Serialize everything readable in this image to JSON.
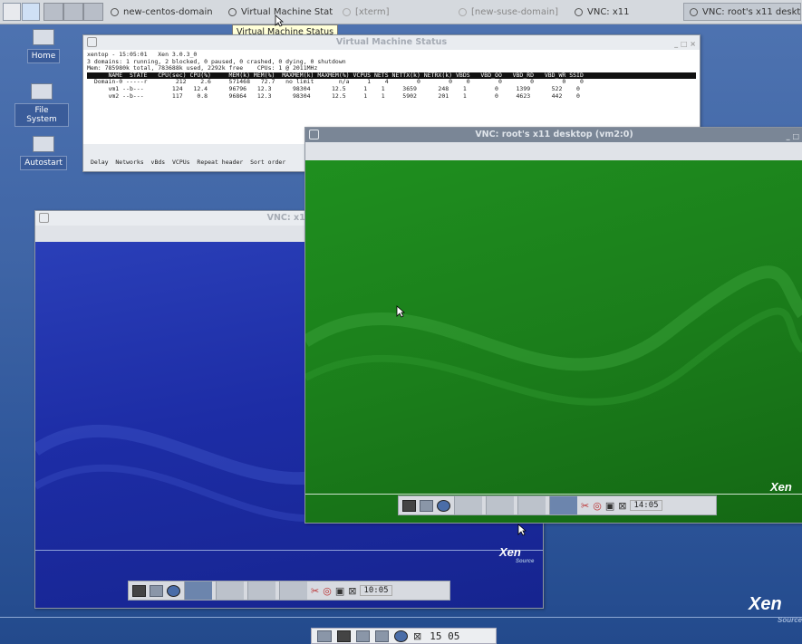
{
  "taskbar": {
    "tasks": [
      {
        "label": "new-centos-domain"
      },
      {
        "label": "Virtual Machine Status"
      },
      {
        "label": "[xterm]"
      },
      {
        "label": "[new-suse-domain]"
      },
      {
        "label": "VNC: x11"
      },
      {
        "label": "VNC: root's x11 deskto..."
      }
    ],
    "tooltip": "Virtual Machine Status"
  },
  "desktop_icons": [
    {
      "label": "Home"
    },
    {
      "label": "File System"
    },
    {
      "label": "Autostart"
    }
  ],
  "vm_status_window": {
    "title": "Virtual Machine Status",
    "lines": [
      "xentop - 15:05:01   Xen 3.0.3_0",
      "3 domains: 1 running, 2 blocked, 0 paused, 0 crashed, 0 dying, 0 shutdown",
      "Mem: 785980k total, 783688k used, 2292k free    CPUs: 1 @ 2011MHz"
    ],
    "header": "      NAME  STATE   CPU(sec) CPU(%)     MEM(k) MEM(%)  MAXMEM(k) MAXMEM(%) VCPUS NETS NETTX(k) NETRX(k) VBDS   VBD_OO   VBD_RD   VBD_WR SSID",
    "rows": [
      "  Domain-0 -----r        212    2.6     571468   72.7   no limit       n/a     1    4        0        0    0        0        0        0    0",
      "      vm1 --b---        124   12.4      96796   12.3      98304      12.5     1    1     3659      248    1        0     1399      522    0",
      "      vm2 --b---        117    0.8      96864   12.3      98304      12.5     1    1     5902      201    1        0     4623      442    0"
    ],
    "footer": "Delay  Networks  vBds  VCPUs  Repeat header  Sort order"
  },
  "vnc_x11_window": {
    "title": "VNC: x11",
    "clock": "10:05"
  },
  "vnc_root_window": {
    "title": "VNC: root's x11 desktop (vm2:0)",
    "clock": "14:05"
  },
  "branding": {
    "logo": "Xen",
    "sub": "Source"
  },
  "bottom_panel": {
    "clock": "15 05"
  },
  "colors": {
    "desktop": "#3f65a6",
    "vnc_blue": "#1a2fa3",
    "vnc_green": "#1d8a1d"
  }
}
